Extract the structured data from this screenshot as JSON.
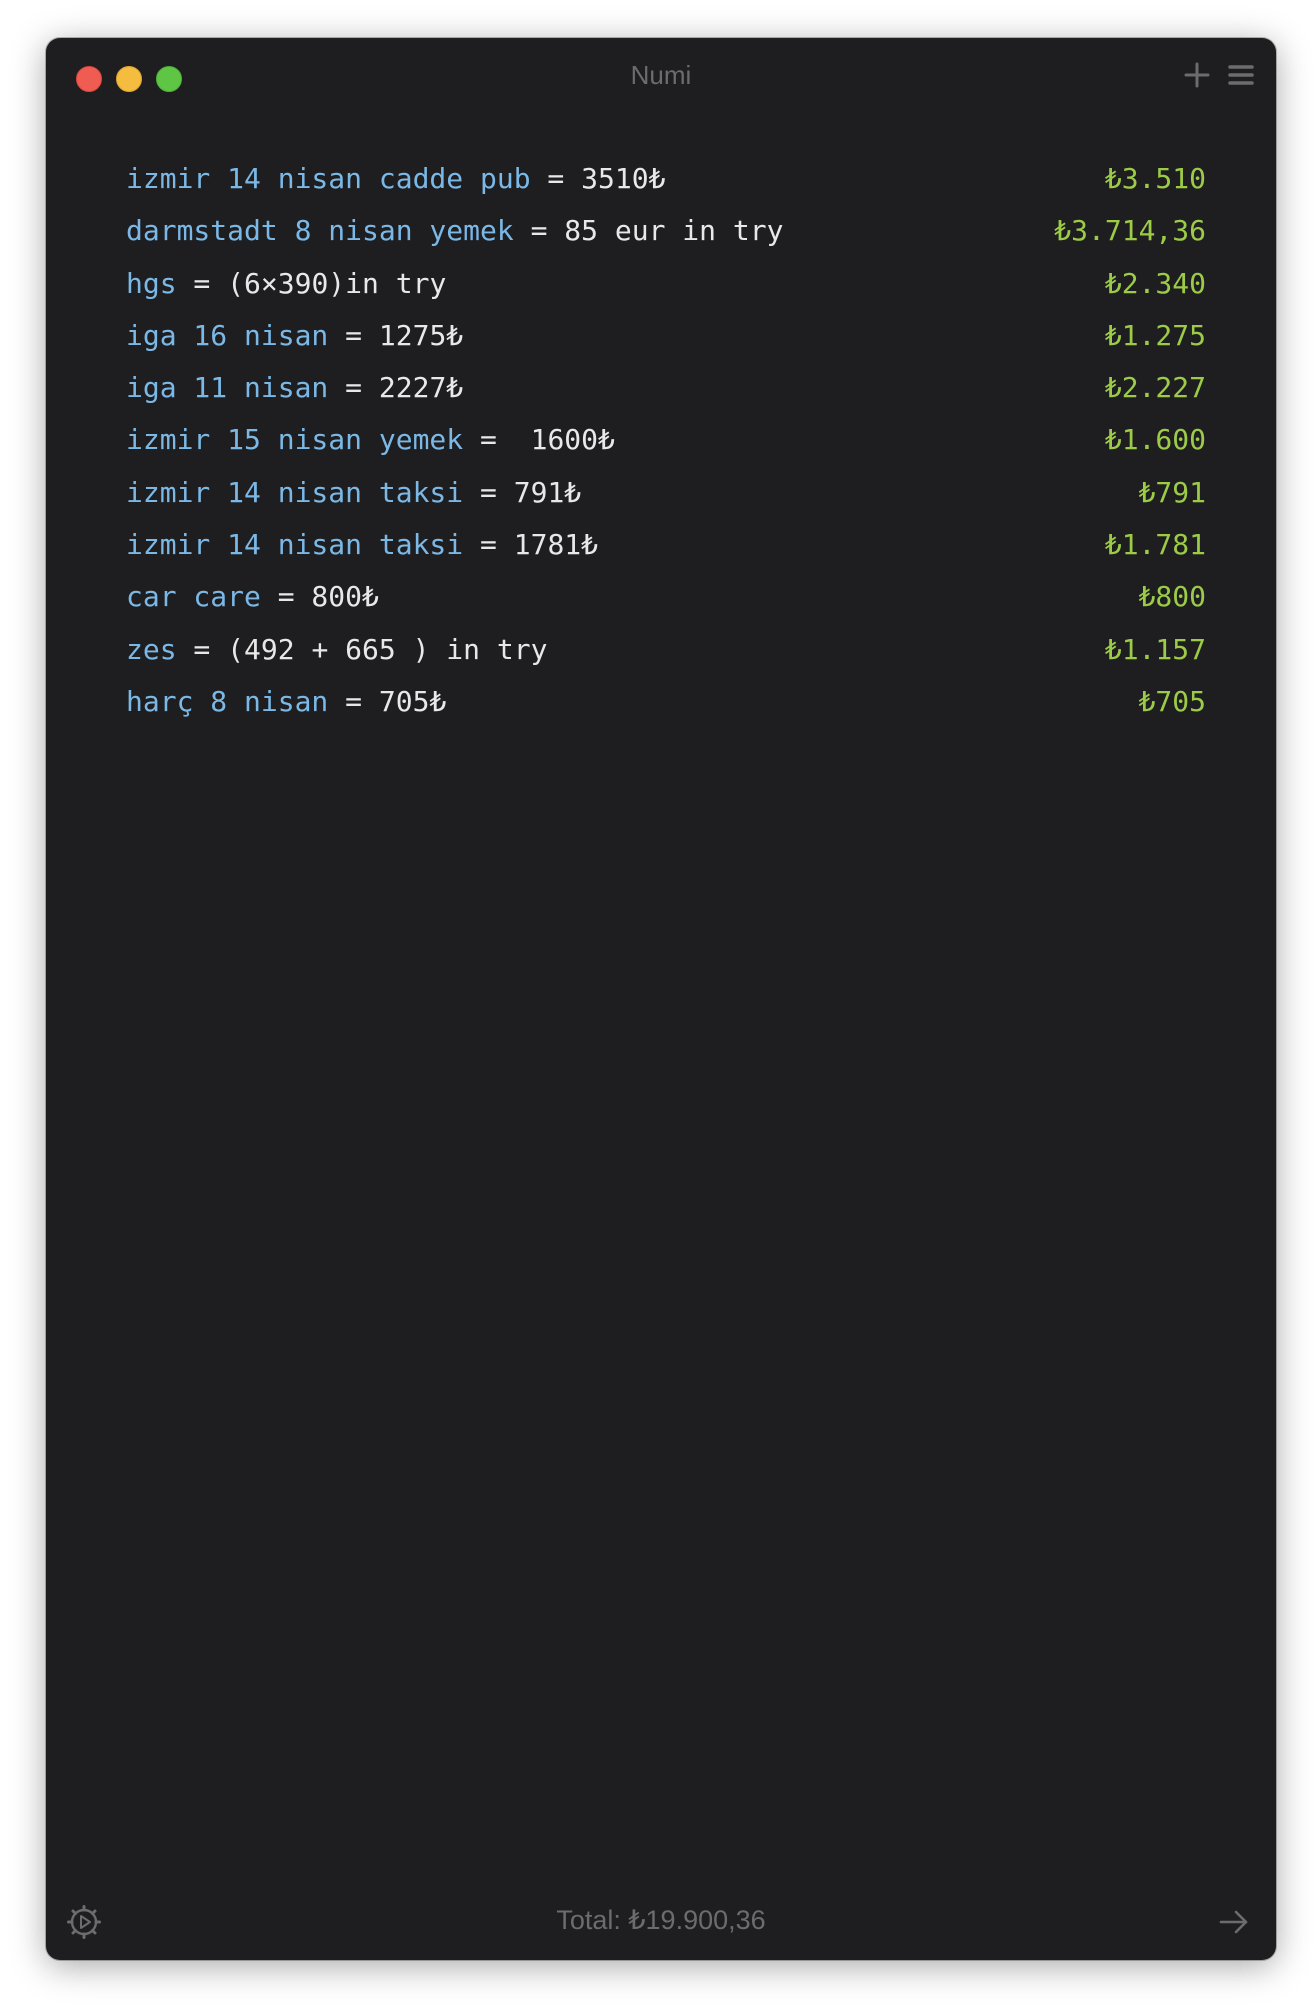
{
  "window": {
    "title": "Numi"
  },
  "toolbar": {
    "add_icon": "plus-icon",
    "menu_icon": "hamburger-menu-icon"
  },
  "lines": [
    {
      "segments": [
        {
          "text": "izmir 14 nisan cadde pub",
          "color": "blue"
        },
        {
          "text": " = 3510₺",
          "color": "white"
        }
      ],
      "result": "₺3.510"
    },
    {
      "segments": [
        {
          "text": "darmstadt 8 nisan yemek",
          "color": "blue"
        },
        {
          "text": " = 85 eur in try",
          "color": "white"
        }
      ],
      "result": "₺3.714,36"
    },
    {
      "segments": [
        {
          "text": "hgs",
          "color": "blue"
        },
        {
          "text": " = (6×390)in try",
          "color": "white"
        }
      ],
      "result": "₺2.340"
    },
    {
      "segments": [
        {
          "text": "iga 16 nisan",
          "color": "blue"
        },
        {
          "text": " = 1275₺",
          "color": "white"
        }
      ],
      "result": "₺1.275"
    },
    {
      "segments": [
        {
          "text": "iga 11 nisan",
          "color": "blue"
        },
        {
          "text": " = 2227₺",
          "color": "white"
        }
      ],
      "result": "₺2.227"
    },
    {
      "segments": [
        {
          "text": "izmir 15 nisan yemek",
          "color": "blue"
        },
        {
          "text": " =  1600₺",
          "color": "white"
        }
      ],
      "result": "₺1.600"
    },
    {
      "segments": [
        {
          "text": "izmir 14 nisan taksi",
          "color": "blue"
        },
        {
          "text": " = 791₺",
          "color": "white"
        }
      ],
      "result": "₺791"
    },
    {
      "segments": [
        {
          "text": "izmir 14 nisan taksi",
          "color": "blue"
        },
        {
          "text": " = 1781₺",
          "color": "white"
        }
      ],
      "result": "₺1.781"
    },
    {
      "segments": [
        {
          "text": "car care",
          "color": "blue"
        },
        {
          "text": " = 800₺",
          "color": "white"
        }
      ],
      "result": "₺800"
    },
    {
      "segments": [
        {
          "text": "zes",
          "color": "blue"
        },
        {
          "text": " = (492 + 665 ) in try",
          "color": "white"
        }
      ],
      "result": "₺1.157"
    },
    {
      "segments": [
        {
          "text": "harç 8 nisan",
          "color": "blue"
        },
        {
          "text": " = 705₺",
          "color": "white"
        }
      ],
      "result": "₺705"
    }
  ],
  "footer": {
    "total": "Total: ₺19.900,36",
    "settings_icon": "settings-gear-icon",
    "arrow_icon": "arrow-right-icon"
  },
  "colors": {
    "background": "#1e1e20",
    "label_blue": "#7bb8e6",
    "text_white": "#e8e8e8",
    "result_green": "#9ccb47",
    "muted_gray": "#6c6c70"
  }
}
